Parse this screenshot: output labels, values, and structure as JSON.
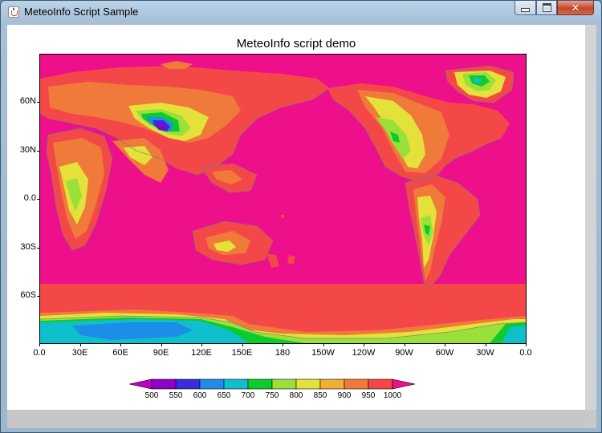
{
  "window": {
    "title": "MeteoInfo Script Sample",
    "controls": {
      "minimize": "minimize",
      "maximize": "maximize",
      "close": "✕"
    }
  },
  "plot": {
    "title": "MeteoInfo script demo"
  },
  "axes": {
    "x_ticks": [
      "0.0",
      "30E",
      "60E",
      "90E",
      "120E",
      "150E",
      "180",
      "150W",
      "120W",
      "90W",
      "60W",
      "30W",
      "0.0"
    ],
    "y_ticks": [
      "60N",
      "30N",
      "0.0",
      "30S",
      "60S"
    ]
  },
  "colorbar": {
    "levels": [
      "500",
      "550",
      "600",
      "650",
      "700",
      "750",
      "800",
      "850",
      "900",
      "950",
      "1000"
    ],
    "colors": [
      "#9000c8",
      "#3b2bd8",
      "#1d8ee8",
      "#0fbfcc",
      "#0ccc2c",
      "#9be03a",
      "#e4e23a",
      "#f0ae36",
      "#f07a3a",
      "#f44848",
      "#ee0f8a"
    ],
    "under_color": "#c000c0",
    "over_color": "#ee0f8a"
  },
  "icons": {
    "app": "java-cup-icon",
    "minimize": "minimize-icon",
    "maximize": "maximize-icon",
    "close": "close-icon"
  }
}
